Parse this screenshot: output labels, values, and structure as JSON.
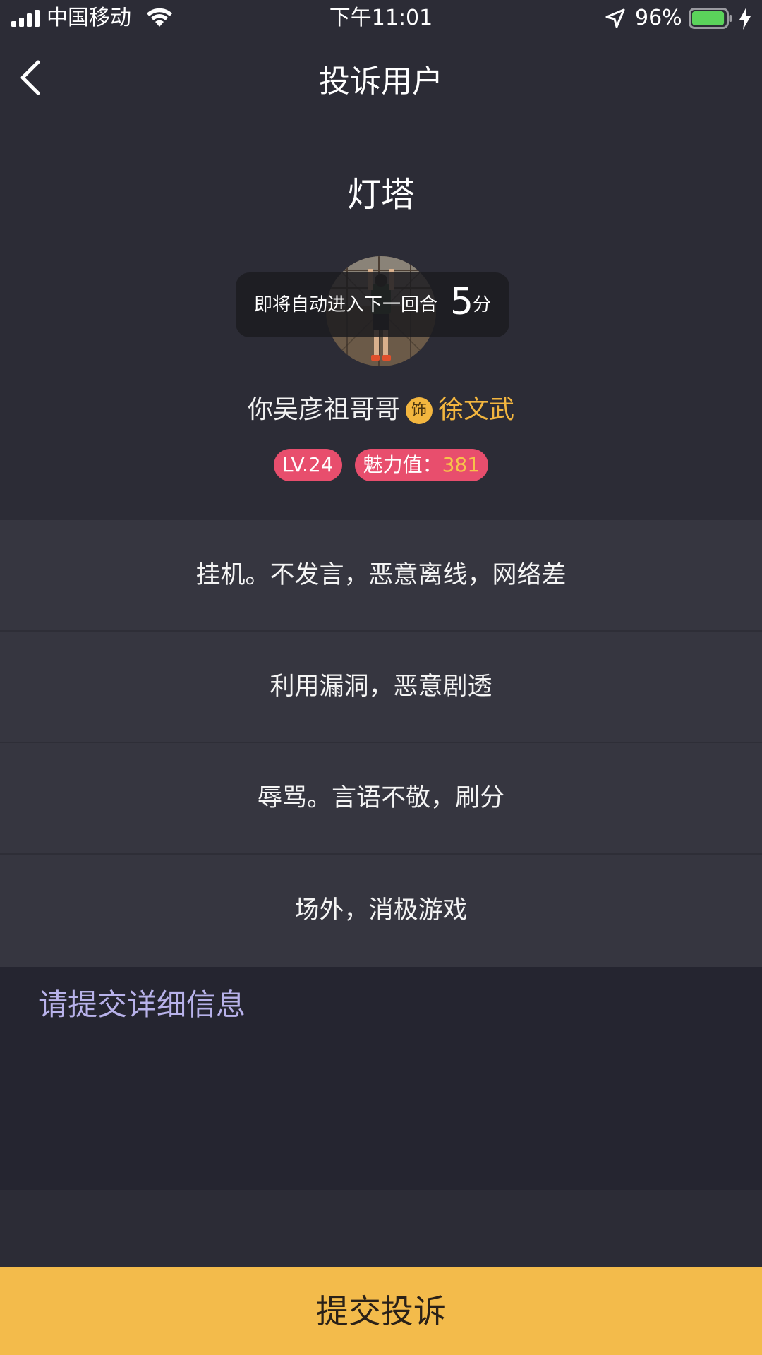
{
  "status_bar": {
    "carrier": "中国移动",
    "time": "下午11:01",
    "battery_percent": "96%",
    "battery_level": 0.96,
    "icons": [
      "signal-icon",
      "wifi-icon",
      "location-arrow-icon",
      "battery-icon",
      "charging-bolt-icon"
    ]
  },
  "nav": {
    "title": "投诉用户",
    "back_icon": "chevron-left-icon"
  },
  "room": {
    "name": "灯塔"
  },
  "countdown": {
    "text": "即将自动进入下一回合",
    "value": "5",
    "unit": "分"
  },
  "user": {
    "name": "你吴彦祖哥哥",
    "role_badge": "饰",
    "role_name": "徐文武",
    "level": "LV.24",
    "charm_label": "魅力值：",
    "charm_value": "381"
  },
  "reasons": [
    "挂机。不发言，恶意离线，网络差",
    "利用漏洞，恶意剧透",
    "辱骂。言语不敬，刷分",
    "场外，消极游戏"
  ],
  "detail": {
    "placeholder": "请提交详细信息"
  },
  "submit": {
    "label": "提交投诉"
  },
  "colors": {
    "background": "#2c2c36",
    "row": "#363640",
    "accent": "#f3bb4b",
    "tag": "#e84e6d",
    "placeholder": "#b8b2ea"
  }
}
